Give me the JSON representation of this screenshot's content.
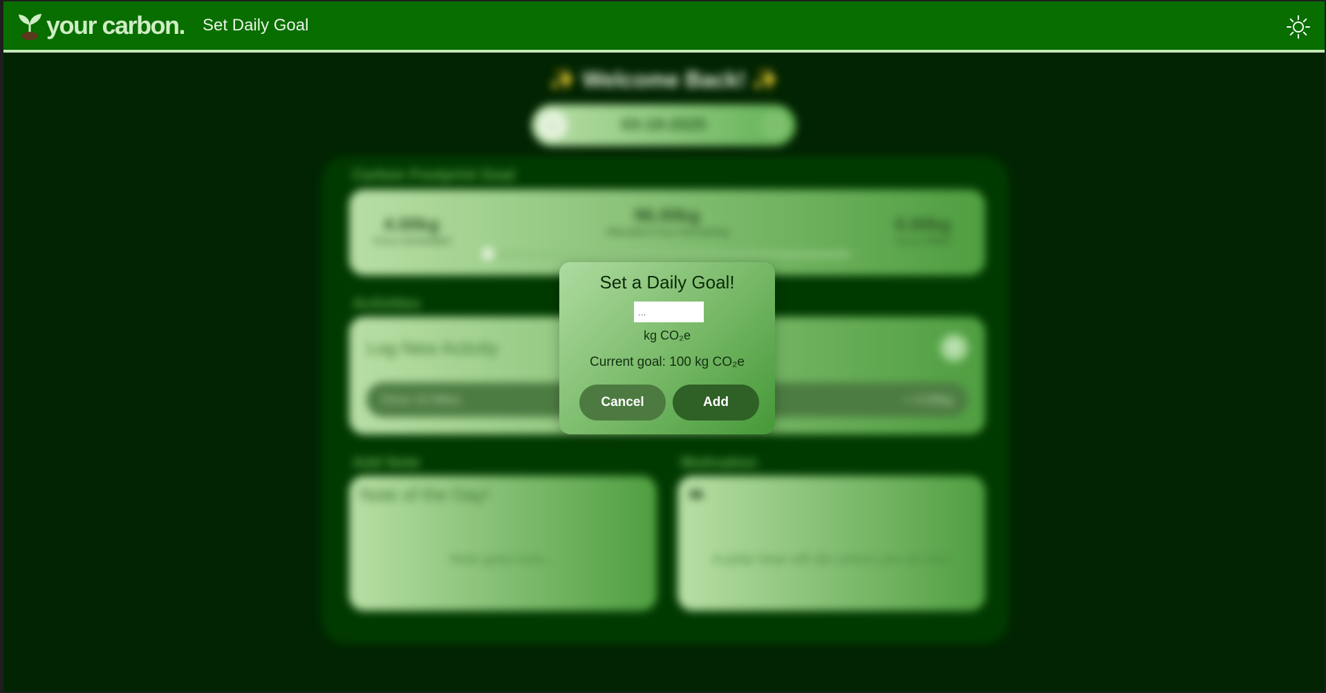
{
  "header": {
    "brand": "your carbon.",
    "page_title": "Set Daily Goal"
  },
  "background": {
    "welcome": "✨ Welcome Back! ✨",
    "date": "03-19-2025",
    "goal_section": {
      "label": "Carbon Footprint Goal",
      "generated_value": "4.00kg",
      "generated_label": "CO₂e Generated",
      "remaining_value": "96.00kg",
      "remaining_label": "Allocated CO₂e Remaining",
      "offset_value": "0.00kg",
      "offset_label": "CO₂e Offset"
    },
    "activities": {
      "label": "Activities",
      "log_title": "Log New Activity",
      "row_left": "Drive 10 Miles",
      "row_right": "+ 4.00kg"
    },
    "note": {
      "label": "Add Note",
      "title": "Note of the Day!",
      "body": "Note goes here..."
    },
    "motivation": {
      "label": "Motivation",
      "quote": "A polar bear will die unless you do this!"
    }
  },
  "modal": {
    "title": "Set a Daily Goal!",
    "input_placeholder": "...",
    "unit": "kg CO₂e",
    "current_goal": "Current goal: 100 kg CO₂e",
    "cancel_label": "Cancel",
    "add_label": "Add"
  },
  "colors": {
    "header_bg": "#096e00",
    "page_bg": "#022402",
    "accent_light": "#c5eab8",
    "cancel_bg": "#4c7a40",
    "add_bg": "#2f6026"
  },
  "icons": {
    "logo": "sprout-icon",
    "theme_toggle": "sun-icon"
  }
}
